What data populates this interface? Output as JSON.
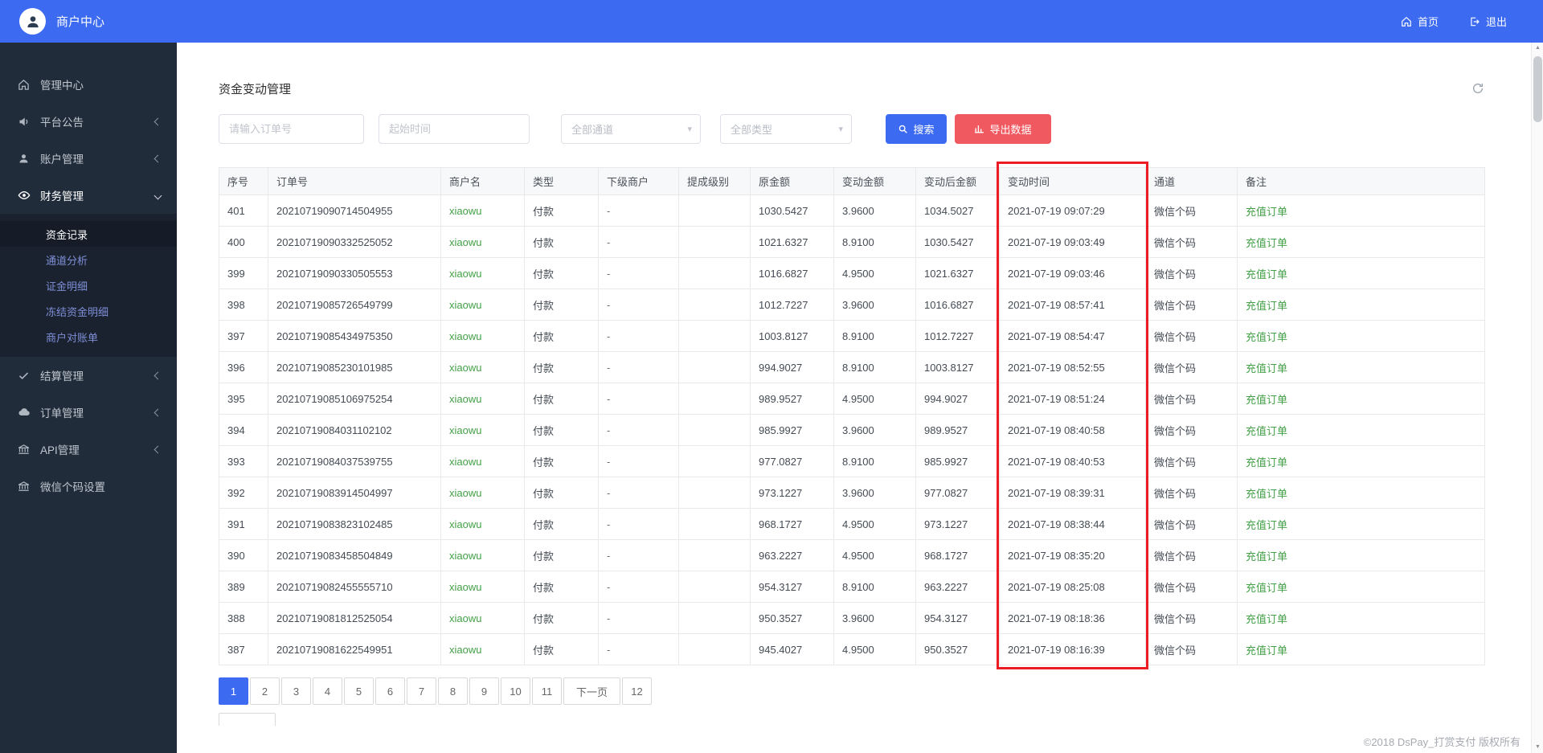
{
  "topbar": {
    "brand": "商户中心",
    "home": "首页",
    "logout": "退出"
  },
  "sidebar": {
    "items": [
      {
        "label": "管理中心",
        "icon": "home-icon"
      },
      {
        "label": "平台公告",
        "icon": "speaker-icon"
      },
      {
        "label": "账户管理",
        "icon": "user-icon"
      },
      {
        "label": "财务管理",
        "icon": "eye-icon"
      },
      {
        "label": "结算管理",
        "icon": "check-icon"
      },
      {
        "label": "订单管理",
        "icon": "cloud-icon"
      },
      {
        "label": "API管理",
        "icon": "bank-icon"
      },
      {
        "label": "微信个码设置",
        "icon": "bank-icon"
      }
    ],
    "finance_submenu": [
      {
        "label": "资金记录",
        "active": true
      },
      {
        "label": "通道分析"
      },
      {
        "label": "证金明细"
      },
      {
        "label": "冻结资金明细"
      },
      {
        "label": "商户对账单"
      }
    ]
  },
  "page": {
    "title": "资金变动管理"
  },
  "filters": {
    "order_placeholder": "请输入订单号",
    "time_placeholder": "起始时间",
    "channel_selected": "全部通道",
    "type_selected": "全部类型",
    "search_label": "搜索",
    "export_label": "导出数据"
  },
  "table": {
    "headers": [
      "序号",
      "订单号",
      "商户名",
      "类型",
      "下级商户",
      "提成级别",
      "原金额",
      "变动金额",
      "变动后金额",
      "变动时间",
      "通道",
      "备注"
    ],
    "rows": [
      [
        "401",
        "20210719090714504955",
        "xiaowu",
        "付款",
        "-",
        "",
        "1030.5427",
        "3.9600",
        "1034.5027",
        "2021-07-19 09:07:29",
        "微信个码",
        "充值订单"
      ],
      [
        "400",
        "20210719090332525052",
        "xiaowu",
        "付款",
        "-",
        "",
        "1021.6327",
        "8.9100",
        "1030.5427",
        "2021-07-19 09:03:49",
        "微信个码",
        "充值订单"
      ],
      [
        "399",
        "20210719090330505553",
        "xiaowu",
        "付款",
        "-",
        "",
        "1016.6827",
        "4.9500",
        "1021.6327",
        "2021-07-19 09:03:46",
        "微信个码",
        "充值订单"
      ],
      [
        "398",
        "20210719085726549799",
        "xiaowu",
        "付款",
        "-",
        "",
        "1012.7227",
        "3.9600",
        "1016.6827",
        "2021-07-19 08:57:41",
        "微信个码",
        "充值订单"
      ],
      [
        "397",
        "20210719085434975350",
        "xiaowu",
        "付款",
        "-",
        "",
        "1003.8127",
        "8.9100",
        "1012.7227",
        "2021-07-19 08:54:47",
        "微信个码",
        "充值订单"
      ],
      [
        "396",
        "20210719085230101985",
        "xiaowu",
        "付款",
        "-",
        "",
        "994.9027",
        "8.9100",
        "1003.8127",
        "2021-07-19 08:52:55",
        "微信个码",
        "充值订单"
      ],
      [
        "395",
        "20210719085106975254",
        "xiaowu",
        "付款",
        "-",
        "",
        "989.9527",
        "4.9500",
        "994.9027",
        "2021-07-19 08:51:24",
        "微信个码",
        "充值订单"
      ],
      [
        "394",
        "20210719084031102102",
        "xiaowu",
        "付款",
        "-",
        "",
        "985.9927",
        "3.9600",
        "989.9527",
        "2021-07-19 08:40:58",
        "微信个码",
        "充值订单"
      ],
      [
        "393",
        "20210719084037539755",
        "xiaowu",
        "付款",
        "-",
        "",
        "977.0827",
        "8.9100",
        "985.9927",
        "2021-07-19 08:40:53",
        "微信个码",
        "充值订单"
      ],
      [
        "392",
        "20210719083914504997",
        "xiaowu",
        "付款",
        "-",
        "",
        "973.1227",
        "3.9600",
        "977.0827",
        "2021-07-19 08:39:31",
        "微信个码",
        "充值订单"
      ],
      [
        "391",
        "20210719083823102485",
        "xiaowu",
        "付款",
        "-",
        "",
        "968.1727",
        "4.9500",
        "973.1227",
        "2021-07-19 08:38:44",
        "微信个码",
        "充值订单"
      ],
      [
        "390",
        "20210719083458504849",
        "xiaowu",
        "付款",
        "-",
        "",
        "963.2227",
        "4.9500",
        "968.1727",
        "2021-07-19 08:35:20",
        "微信个码",
        "充值订单"
      ],
      [
        "389",
        "20210719082455555710",
        "xiaowu",
        "付款",
        "-",
        "",
        "954.3127",
        "8.9100",
        "963.2227",
        "2021-07-19 08:25:08",
        "微信个码",
        "充值订单"
      ],
      [
        "388",
        "20210719081812525054",
        "xiaowu",
        "付款",
        "-",
        "",
        "950.3527",
        "3.9600",
        "954.3127",
        "2021-07-19 08:18:36",
        "微信个码",
        "充值订单"
      ],
      [
        "387",
        "20210719081622549951",
        "xiaowu",
        "付款",
        "-",
        "",
        "945.4027",
        "4.9500",
        "950.3527",
        "2021-07-19 08:16:39",
        "微信个码",
        "充值订单"
      ]
    ]
  },
  "pagination": {
    "pages": [
      "1",
      "2",
      "3",
      "4",
      "5",
      "6",
      "7",
      "8",
      "9",
      "10",
      "11",
      "下一页",
      "12"
    ],
    "active_page": "1"
  },
  "footer": {
    "copyright": "©2018 DsPay_打赏支付 版权所有"
  },
  "colors": {
    "accent": "#3c6af0",
    "export_button": "#f0595f",
    "success_green": "#43a047",
    "annotation_red": "#ed1b24",
    "sidebar_bg": "#212c3b"
  }
}
